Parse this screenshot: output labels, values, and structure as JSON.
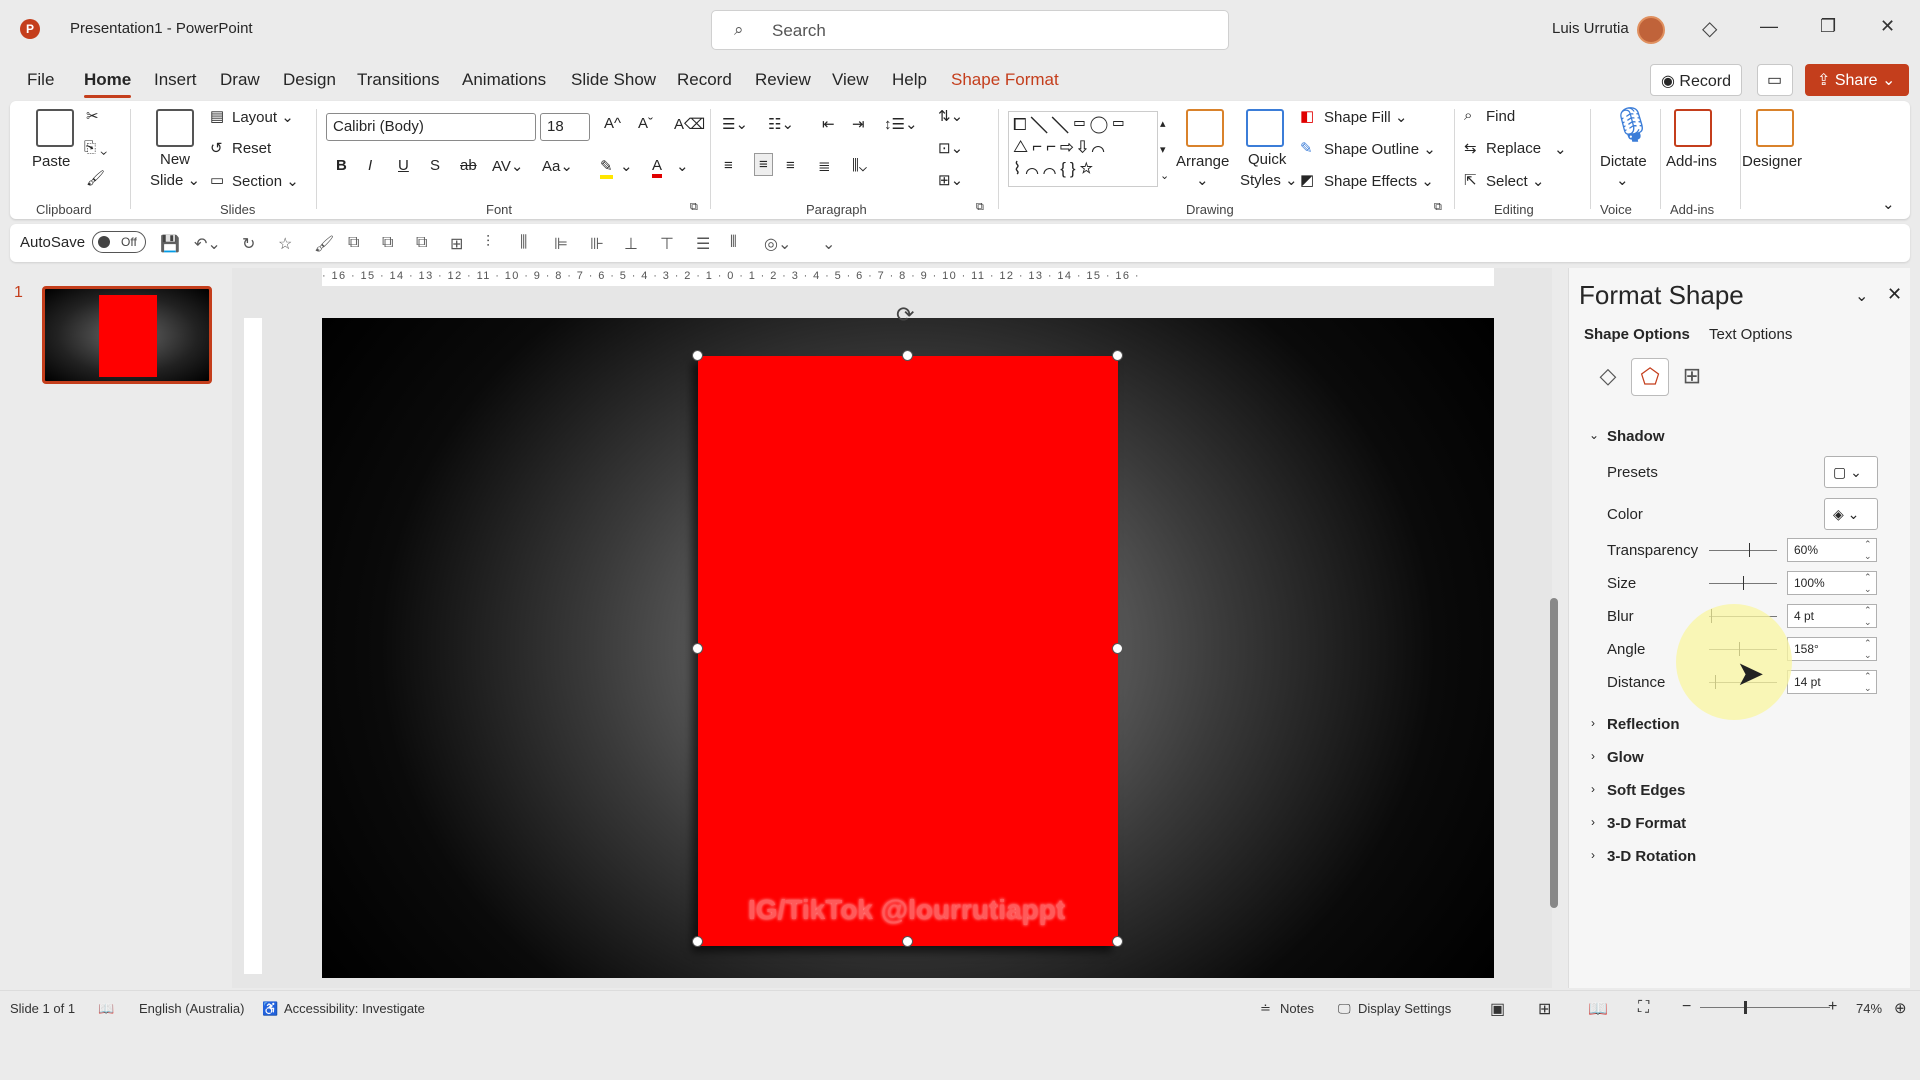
{
  "titlebar": {
    "doc_title": "Presentation1  -  PowerPoint",
    "search_placeholder": "Search",
    "user_name": "Luis Urrutia",
    "logo_letter": "P",
    "minimize": "—",
    "restore": "❐",
    "close": "✕"
  },
  "menu": {
    "file": "File",
    "home": "Home",
    "insert": "Insert",
    "draw": "Draw",
    "design": "Design",
    "transitions": "Transitions",
    "animations": "Animations",
    "slideshow": "Slide Show",
    "record": "Record",
    "review": "Review",
    "view": "View",
    "help": "Help",
    "shape_format": "Shape Format",
    "record_button": "Record",
    "share_button": "Share"
  },
  "ribbon": {
    "clipboard": {
      "label": "Clipboard",
      "paste": "Paste"
    },
    "slides": {
      "label": "Slides",
      "new_slide": "New",
      "new_slide2": "Slide ⌄",
      "layout": "Layout ⌄",
      "reset": "Reset",
      "section": "Section ⌄"
    },
    "font": {
      "label": "Font",
      "font_name": "Calibri (Body)",
      "font_size": "18"
    },
    "paragraph": {
      "label": "Paragraph"
    },
    "drawing": {
      "label": "Drawing",
      "arrange": "Arrange",
      "quick_styles": "Quick",
      "quick_styles2": "Styles ⌄",
      "shape_fill": "Shape Fill ⌄",
      "shape_outline": "Shape Outline ⌄",
      "shape_effects": "Shape Effects ⌄"
    },
    "editing": {
      "label": "Editing",
      "find": "Find",
      "replace": "Replace",
      "select": "Select ⌄"
    },
    "voice": {
      "label": "Voice",
      "dictate": "Dictate"
    },
    "addins": {
      "label": "Add-ins",
      "addins": "Add-ins"
    },
    "designer": {
      "label": "Designer"
    }
  },
  "qat": {
    "autosave": "AutoSave",
    "toggle": "Off"
  },
  "thumbnails": {
    "slide_number": "1"
  },
  "ruler": {
    "ticks": "· 16 · 15 · 14 · 13 · 12 · 11 · 10 · 9 · 8 · 7 · 6 · 5 · 4 · 3 · 2 · 1 · 0 · 1 · 2 · 3 · 4 · 5 · 6 · 7 · 8 · 9 · 10 · 11 · 12 · 13 · 14 · 15 · 16 ·"
  },
  "slide": {
    "watermark": "IG/TikTok @lourrutiappt",
    "shape_color": "#ff0000"
  },
  "format_pane": {
    "title": "Format Shape",
    "tab_shape": "Shape Options",
    "tab_text": "Text Options",
    "shadow": "Shadow",
    "presets": "Presets",
    "color": "Color",
    "transparency": "Transparency",
    "transparency_val": "60%",
    "size": "Size",
    "size_val": "100%",
    "blur": "Blur",
    "blur_val": "4 pt",
    "angle": "Angle",
    "angle_val": "158°",
    "distance": "Distance",
    "distance_val": "14 pt",
    "reflection": "Reflection",
    "glow": "Glow",
    "soft_edges": "Soft Edges",
    "format_3d": "3-D Format",
    "rotation_3d": "3-D Rotation"
  },
  "status": {
    "slide_of": "Slide 1 of 1",
    "language": "English (Australia)",
    "accessibility": "Accessibility: Investigate",
    "notes": "Notes",
    "display_settings": "Display Settings",
    "zoom": "74%"
  },
  "colors": {
    "accent": "#c43e1c",
    "shape": "#ff0000"
  }
}
